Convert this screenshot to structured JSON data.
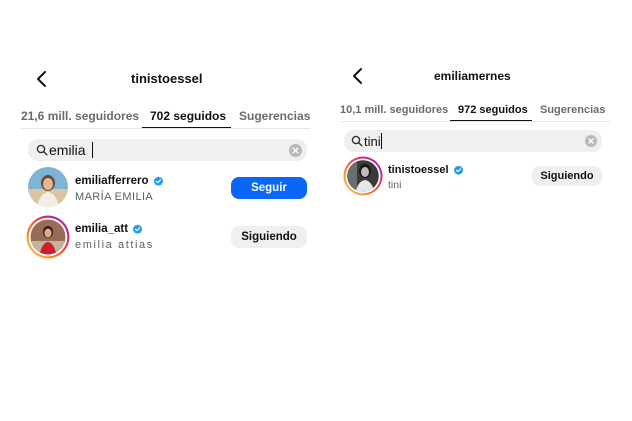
{
  "left": {
    "title": "tinistoessel",
    "tabs": [
      {
        "label": "21,6 mill. seguidores"
      },
      {
        "label": "702 seguidos"
      },
      {
        "label": "Sugerencias"
      }
    ],
    "search": {
      "value": "emilia"
    },
    "results": [
      {
        "username": "emiliafferrero",
        "full_name": "MARÍA EMILIA",
        "button": "Seguir"
      },
      {
        "username": "emilia_att",
        "full_name": "emilia attias",
        "button": "Siguiendo"
      }
    ]
  },
  "right": {
    "title": "emiliamernes",
    "tabs": [
      {
        "label": "10,1 mill. seguidores"
      },
      {
        "label": "972 seguidos"
      },
      {
        "label": "Sugerencias"
      }
    ],
    "search": {
      "value": "tini"
    },
    "results": [
      {
        "username": "tinistoessel",
        "full_name": "tini",
        "button": "Siguiendo"
      }
    ]
  },
  "colors": {
    "primary_button": "#0a66f6",
    "verified_badge": "#1d9bf0",
    "story_ring": [
      "#feda75",
      "#fa7e1e",
      "#d62976",
      "#962fbf"
    ]
  },
  "icons": [
    "back-arrow-icon",
    "search-icon",
    "clear-icon",
    "verified-badge-icon"
  ]
}
